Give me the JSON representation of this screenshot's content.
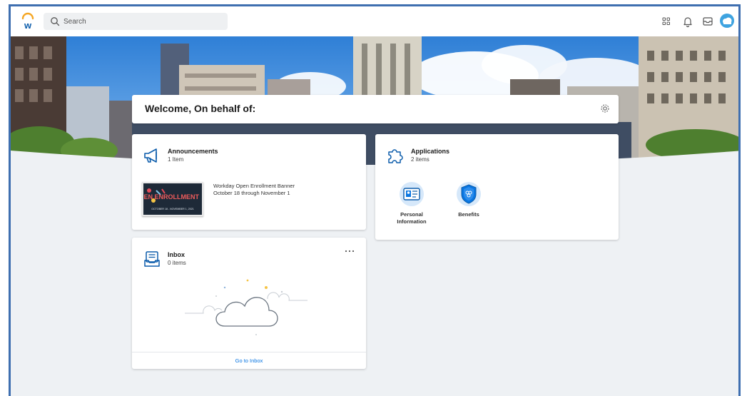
{
  "topbar": {
    "logo_icon": "workday-logo-icon",
    "search_placeholder": "Search",
    "icons": [
      "apps-grid-icon",
      "notifications-bell-icon",
      "inbox-tray-icon",
      "profile-avatar"
    ]
  },
  "welcome": {
    "title": "Welcome, On behalf of:",
    "settings_icon": "gear-icon"
  },
  "announcements": {
    "title": "Announcements",
    "count": "1 Item",
    "icon": "megaphone-icon",
    "item": {
      "title": "Workday Open Enrollment Banner",
      "dates": "October 18 through November 1",
      "banner_text": "OPEN ENROLLMENT",
      "banner_dates": "OCTOBER 18 - NOVEMBER 1, 2021"
    }
  },
  "applications": {
    "title": "Applications",
    "count": "2 items",
    "icon": "puzzle-piece-icon",
    "tiles": [
      {
        "label": "Personal Information",
        "icon": "id-card-icon"
      },
      {
        "label": "Benefits",
        "icon": "shield-icon"
      }
    ]
  },
  "inbox": {
    "title": "Inbox",
    "count": "0 items",
    "icon": "inbox-tray-icon",
    "more_icon": "more-options-icon",
    "empty_icon": "cloud-icon",
    "link": "Go to Inbox"
  },
  "colors": {
    "accent_blue": "#0875e1",
    "workday_orange": "#f5a623",
    "frame_border": "#3f6fb0",
    "background": "#eef1f4"
  }
}
